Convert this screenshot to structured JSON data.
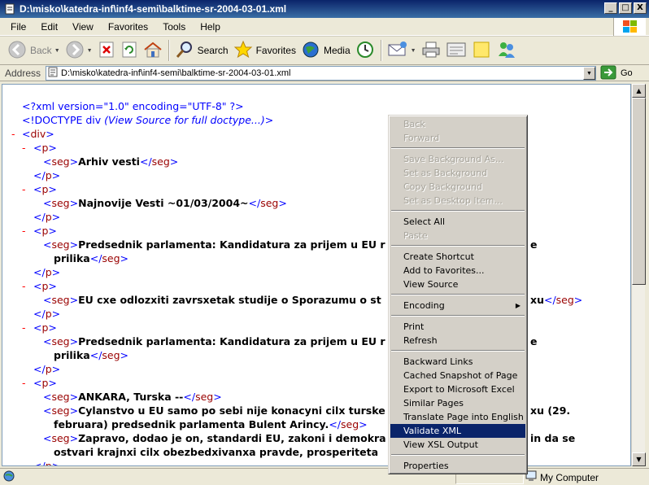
{
  "window": {
    "title": "D:\\misko\\katedra-inf\\inf4-semi\\balktime-sr-2004-03-01.xml",
    "min_label": "_",
    "max_label": "□",
    "close_label": "X"
  },
  "menubar": [
    "File",
    "Edit",
    "View",
    "Favorites",
    "Tools",
    "Help"
  ],
  "toolbar": {
    "back_label": "Back",
    "search_label": "Search",
    "favorites_label": "Favorites",
    "media_label": "Media"
  },
  "address": {
    "label": "Address",
    "value": "D:\\misko\\katedra-inf\\inf4-semi\\balktime-sr-2004-03-01.xml",
    "go_label": "Go"
  },
  "xml": {
    "pi": "<?xml version=\"1.0\" encoding=\"UTF-8\" ?>",
    "doctype": "<!DOCTYPE div",
    "doctype_note": "(View Source for full doctype...)",
    "doctype_end": ">",
    "minus": "-",
    "div": "div",
    "p": "p",
    "seg": "seg",
    "lines": {
      "t1": "Arhiv vesti",
      "t2": "Najnovije Vesti ~01/03/2004~",
      "t3a": "Predsednik parlamenta: Kandidatura za prijem u EU r",
      "t3b": "e",
      "t3c": "prilika",
      "t4a": "EU cxe odlozxiti zavrsxetak studije o Sporazumu o st",
      "t4b": "xu",
      "t5a": "Predsednik parlamenta: Kandidatura za prijem u EU r",
      "t5b": "e",
      "t5c": "prilika",
      "t6": "ANKARA, Turska --",
      "t7a": "Cylanstvo u EU samo po sebi nije konacyni cilx turske",
      "t7b": "xu (29.",
      "t7c": "februara) predsednik parlamenta Bulent Arincy.",
      "t8a": "Zapravo, dodao je on, standardi EU, zakoni i demokra",
      "t8b": "in da se",
      "t8c": "ostvari krajnxi cilx obezbedxivanxa pravde, prosperiteta"
    }
  },
  "status": {
    "zone": "My Computer"
  },
  "context_menu": {
    "items": [
      {
        "label": "Back",
        "enabled": false
      },
      {
        "label": "Forward",
        "enabled": false
      },
      {
        "label": "Save Background As...",
        "enabled": false
      },
      {
        "label": "Set as Background",
        "enabled": false
      },
      {
        "label": "Copy Background",
        "enabled": false
      },
      {
        "label": "Set as Desktop Item...",
        "enabled": false
      },
      {
        "label": "Select All",
        "enabled": true
      },
      {
        "label": "Paste",
        "enabled": false
      },
      {
        "label": "Create Shortcut",
        "enabled": true
      },
      {
        "label": "Add to Favorites...",
        "enabled": true
      },
      {
        "label": "View Source",
        "enabled": true
      },
      {
        "label": "Encoding",
        "enabled": true
      },
      {
        "label": "Print",
        "enabled": true
      },
      {
        "label": "Refresh",
        "enabled": true
      },
      {
        "label": "Backward Links",
        "enabled": true
      },
      {
        "label": "Cached Snapshot of Page",
        "enabled": true
      },
      {
        "label": "Export to Microsoft Excel",
        "enabled": true
      },
      {
        "label": "Similar Pages",
        "enabled": true
      },
      {
        "label": "Translate Page into English",
        "enabled": true
      },
      {
        "label": "Validate XML",
        "enabled": true,
        "highlighted": true
      },
      {
        "label": "View XSL Output",
        "enabled": true
      },
      {
        "label": "Properties",
        "enabled": true
      }
    ]
  }
}
